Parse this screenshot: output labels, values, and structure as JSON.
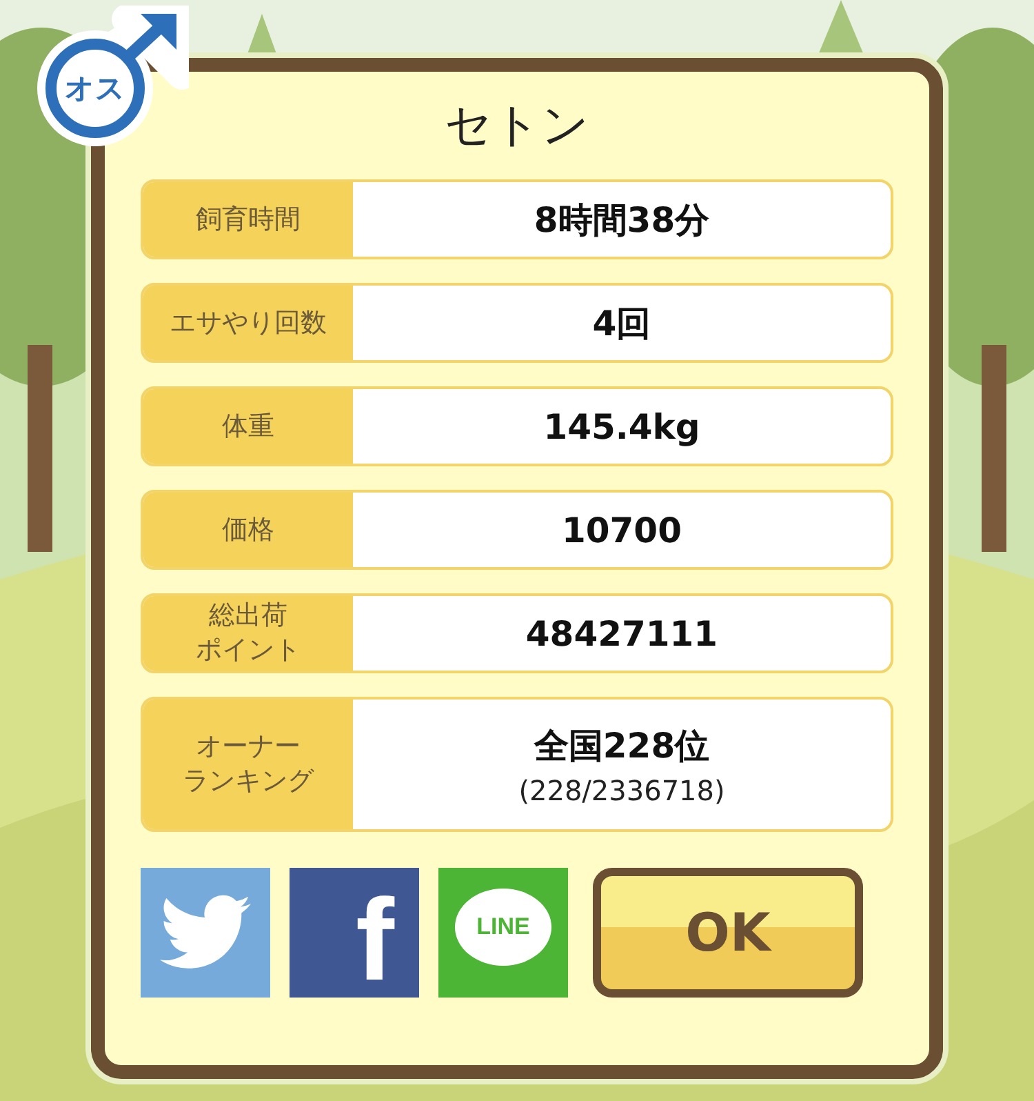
{
  "badge": {
    "text": "オス"
  },
  "dialog": {
    "title": "セトン",
    "rows": [
      {
        "label": "飼育時間",
        "value": "8時間38分"
      },
      {
        "label": "エサやり回数",
        "value": "4回"
      },
      {
        "label": "体重",
        "value": "145.4kg"
      },
      {
        "label": "価格",
        "value": "10700"
      },
      {
        "label_lines": [
          "総出荷",
          "ポイント"
        ],
        "value": "48427111"
      },
      {
        "label_lines": [
          "オーナー",
          "ランキング"
        ],
        "value": "全国228位",
        "sub": "(228/2336718)"
      }
    ],
    "share_buttons": [
      {
        "kind": "twitter"
      },
      {
        "kind": "facebook",
        "text": "f"
      },
      {
        "kind": "line",
        "text": "LINE"
      }
    ],
    "ok_button": {
      "label": "OK"
    }
  }
}
